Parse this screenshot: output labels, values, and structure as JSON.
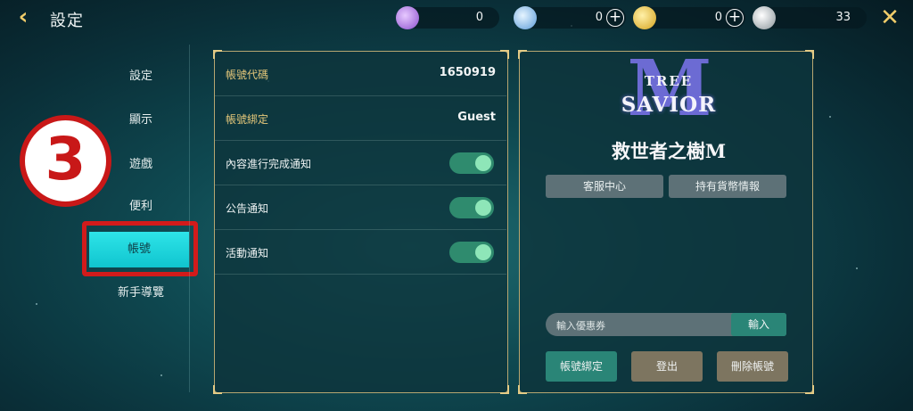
{
  "topbar": {
    "title": "設定",
    "currencies": [
      {
        "icon": "purple-gem-icon",
        "value": "0",
        "has_plus": false
      },
      {
        "icon": "blue-crystal-icon",
        "value": "0",
        "has_plus": true
      },
      {
        "icon": "gold-coin-icon",
        "value": "0",
        "has_plus": true
      },
      {
        "icon": "silver-medal-icon",
        "value": "33",
        "has_plus": false
      }
    ]
  },
  "sidebar": {
    "items": [
      {
        "label": "設定"
      },
      {
        "label": "顯示"
      },
      {
        "label": "遊戲"
      },
      {
        "label": "便利"
      },
      {
        "label": "帳號",
        "active": true
      },
      {
        "label": "新手導覽"
      }
    ],
    "step_badge": "3"
  },
  "account": {
    "code_label": "帳號代碼",
    "code_value": "1650919",
    "bind_label": "帳號綁定",
    "bind_value": "Guest",
    "notifications": [
      {
        "label": "內容進行完成通知",
        "on": true
      },
      {
        "label": "公告通知",
        "on": true
      },
      {
        "label": "活動通知",
        "on": true
      }
    ]
  },
  "right": {
    "logo": {
      "m": "M",
      "tree": "TREE",
      "savior": "SAVIOR",
      "chinese": "救世者之樹M"
    },
    "support_button": "客服中心",
    "currency_info_button": "持有貨幣情報",
    "coupon_placeholder": "輸入優惠券",
    "coupon_button": "輸入",
    "bind_button": "帳號綁定",
    "logout_button": "登出",
    "delete_button": "刪除帳號"
  },
  "colors": {
    "accent_gold": "#e6c87a",
    "active_tab": "#1fd6dd",
    "toggle_on": "#2f8b6e",
    "highlight_red": "#d21b1b",
    "bind_button": "#2a8577",
    "logout_button": "#7d7560",
    "delete_button": "#7d7560"
  }
}
